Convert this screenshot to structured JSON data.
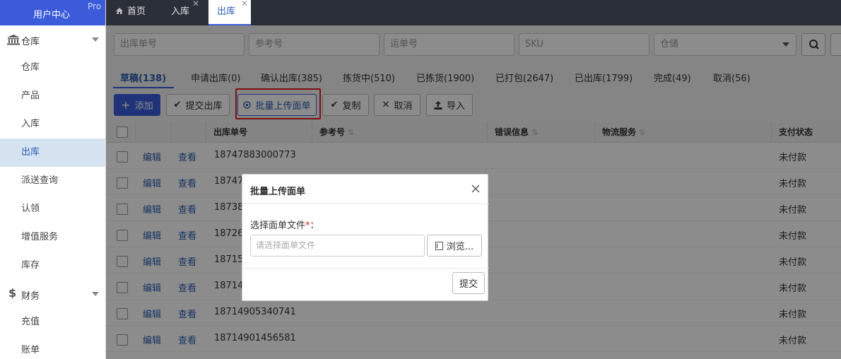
{
  "brand": {
    "title": "用户中心",
    "badge": "Pro"
  },
  "sidebar": {
    "groups": [
      {
        "label": "仓库",
        "icon": "bank-icon",
        "items": [
          "仓库",
          "产品",
          "入库",
          "出库",
          "派送查询",
          "认领",
          "增值服务",
          "库存"
        ]
      },
      {
        "label": "财务",
        "icon": "dollar-icon",
        "items": [
          "充值",
          "账单"
        ]
      }
    ],
    "active_item": "出库"
  },
  "top_tabs": [
    {
      "label": "首页",
      "icon": "home-icon"
    },
    {
      "label": "入库",
      "closable": true
    },
    {
      "label": "出库",
      "closable": true,
      "active": true
    }
  ],
  "filters": {
    "outbound_no": "出库单号",
    "reference_no": "参考号",
    "waybill_no": "运单号",
    "sku": "SKU",
    "warehouse": "仓储"
  },
  "status_tabs": [
    {
      "label": "草稿(138)",
      "active": true
    },
    {
      "label": "申请出库(0)"
    },
    {
      "label": "确认出库(385)"
    },
    {
      "label": "拣货中(510)"
    },
    {
      "label": "已拣货(1900)"
    },
    {
      "label": "已打包(2647)"
    },
    {
      "label": "已出库(1799)"
    },
    {
      "label": "完成(49)"
    },
    {
      "label": "取消(56)"
    }
  ],
  "toolbar": {
    "add": "添加",
    "submit_outbound": "提交出库",
    "batch_upload": "批量上传面单",
    "copy": "复制",
    "cancel": "取消",
    "import": "导入"
  },
  "table": {
    "columns": [
      "出库单号",
      "参考号",
      "错误信息",
      "物流服务",
      "支付状态"
    ],
    "action_edit": "编辑",
    "action_view": "查看",
    "rows": [
      {
        "order_no": "18747883000773",
        "pay_status": "未付款"
      },
      {
        "order_no": "187474",
        "pay_status": "未付款"
      },
      {
        "order_no": "187383",
        "pay_status": "未付款"
      },
      {
        "order_no": "187262",
        "pay_status": "未付款"
      },
      {
        "order_no": "187154",
        "pay_status": "未付款"
      },
      {
        "order_no": "187149",
        "pay_status": "未付款"
      },
      {
        "order_no": "18714905340741",
        "pay_status": "未付款"
      },
      {
        "order_no": "18714901456581",
        "pay_status": "未付款"
      }
    ]
  },
  "modal": {
    "title": "批量上传面单",
    "field_label": "选择面单文件",
    "required_mark": "*",
    "colon": "：",
    "placeholder": "请选择面单文件",
    "browse": "浏览...",
    "submit": "提交"
  }
}
